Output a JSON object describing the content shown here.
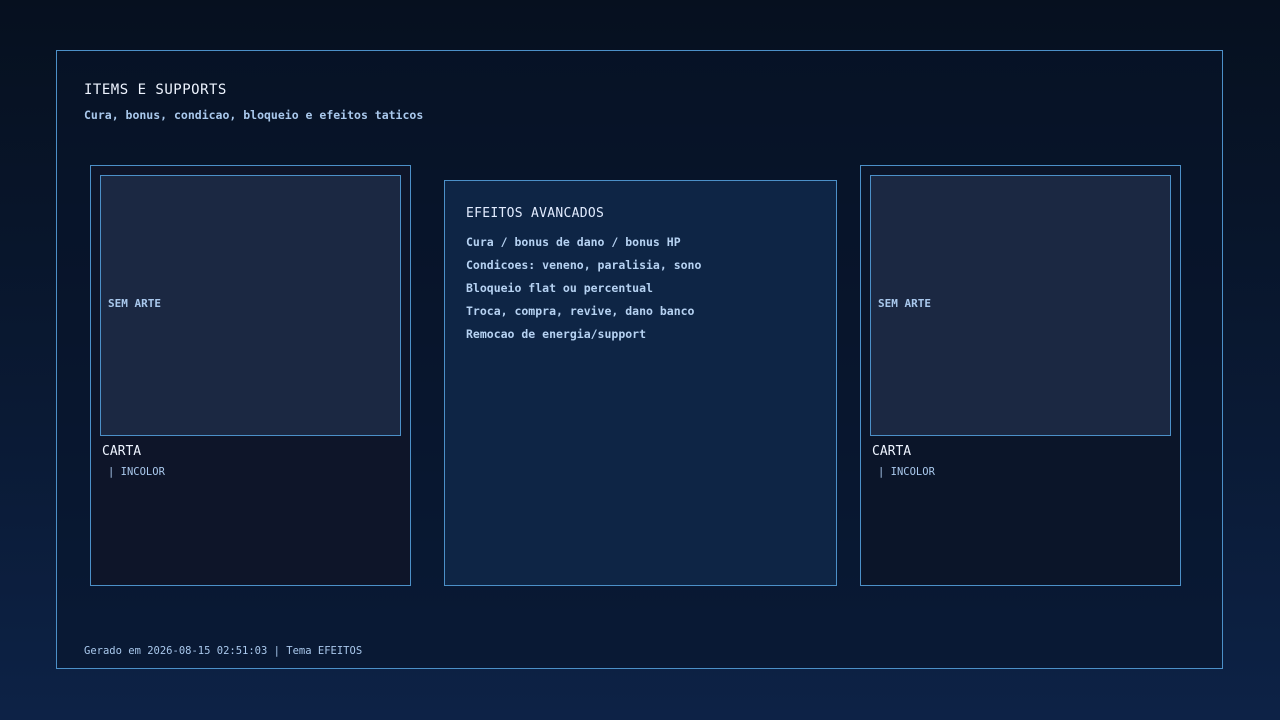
{
  "header": {
    "title": "ITEMS E SUPPORTS",
    "subtitle": "Cura, bonus, condicao, bloqueio e efeitos taticos"
  },
  "cards": [
    {
      "art_label": "SEM ARTE",
      "name": "CARTA",
      "meta": "| INCOLOR"
    },
    {
      "art_label": "SEM ARTE",
      "name": "CARTA",
      "meta": "| INCOLOR"
    }
  ],
  "effects": {
    "title": "EFEITOS AVANCADOS",
    "items": [
      "Cura / bonus de dano / bonus HP",
      "Condicoes: veneno, paralisia, sono",
      "Bloqueio flat ou percentual",
      "Troca, compra, revive, dano banco",
      "Remocao de energia/support"
    ]
  },
  "footer": {
    "text": "Gerado em 2026-08-15 02:51:03 | Tema EFEITOS"
  },
  "colors": {
    "border": "#4c90c8",
    "background": "#06101f",
    "panel": "#0e2545",
    "card_art": "#1b2842",
    "text_primary": "#eef4ff",
    "text_secondary": "#a9c8ec"
  }
}
